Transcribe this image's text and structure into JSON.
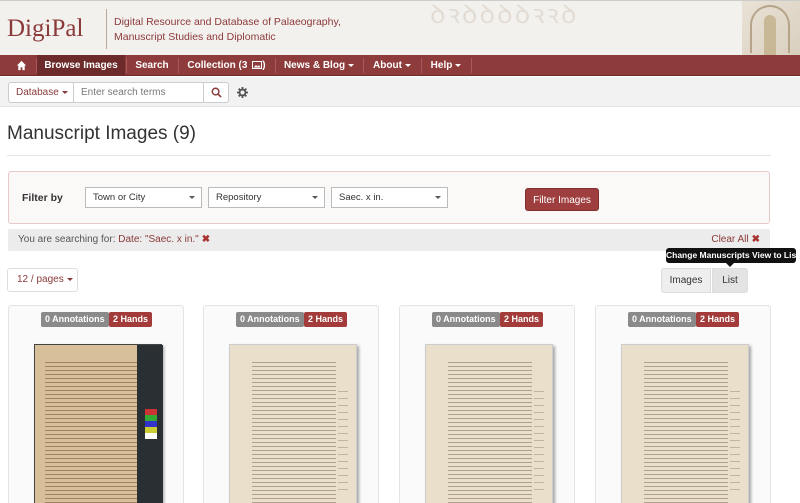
{
  "header": {
    "logo": "DigiPal",
    "subtitle": "Digital Resource and Database of Palaeography, Manuscript Studies and Diplomatic"
  },
  "nav": {
    "home_icon": "home-icon",
    "items": [
      {
        "label": "Browse Images",
        "active": true,
        "dropdown": false
      },
      {
        "label": "Search",
        "active": false,
        "dropdown": false
      },
      {
        "label": "Collection (3",
        "suffix": ")",
        "icon": "image-icon",
        "active": false,
        "dropdown": false
      },
      {
        "label": "News & Blog",
        "active": false,
        "dropdown": true
      },
      {
        "label": "About",
        "active": false,
        "dropdown": true
      },
      {
        "label": "Help",
        "active": false,
        "dropdown": true
      }
    ]
  },
  "search": {
    "database_label": "Database",
    "placeholder": "Enter search terms",
    "value": ""
  },
  "page_title": "Manuscript Images (9)",
  "filter": {
    "label": "Filter by",
    "selects": [
      "Town or City",
      "Repository",
      "Saec. x in."
    ],
    "button": "Filter Images"
  },
  "searching": {
    "prefix": "You are searching for:",
    "value": "Date: \"Saec. x in.\"",
    "clear_all": "Clear All"
  },
  "pages_dropdown": "12 / pages",
  "view_toggle": {
    "images": "Images",
    "list": "List",
    "tooltip": "Change Manuscripts View to List"
  },
  "cards": [
    {
      "annotations": "0 Annotations",
      "hands": "2 Hands"
    },
    {
      "annotations": "0 Annotations",
      "hands": "2 Hands"
    },
    {
      "annotations": "0 Annotations",
      "hands": "2 Hands"
    },
    {
      "annotations": "0 Annotations",
      "hands": "2 Hands"
    }
  ],
  "colors": {
    "brand": "#8e3b3b",
    "brand_dark": "#6d2a2a",
    "badge_gray": "#8a8a8a",
    "badge_red": "#a33b3b"
  }
}
